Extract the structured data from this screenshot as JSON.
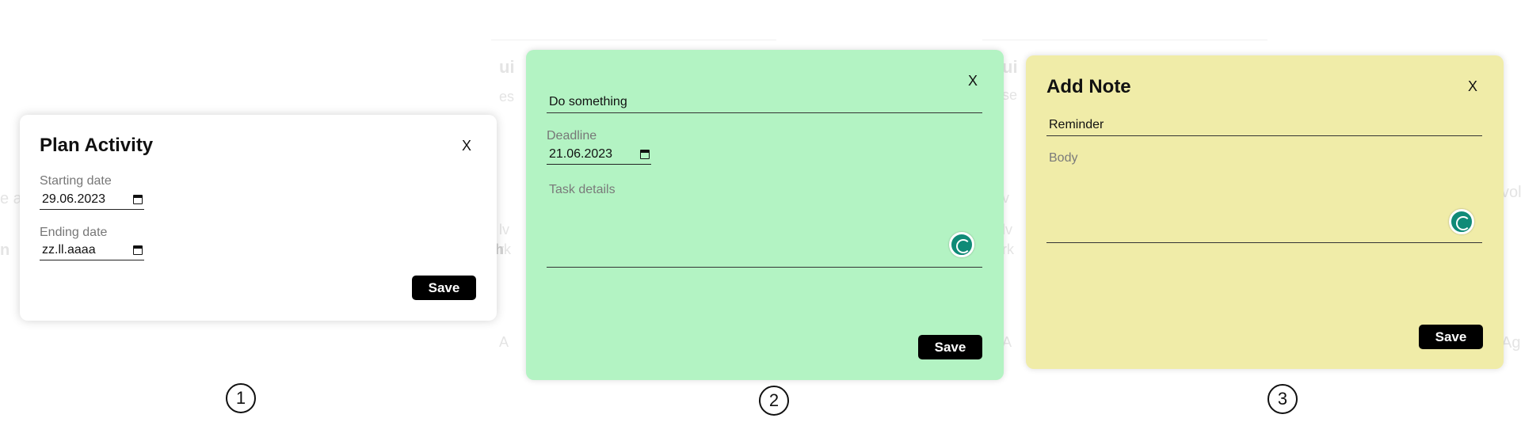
{
  "colors": {
    "modal1_bg": "#ffffff",
    "modal2_bg": "#b3f3c3",
    "modal3_bg": "#f0eca8",
    "button_bg": "#000000",
    "button_text": "#ffffff",
    "grammarly_icon": "#0f8a77"
  },
  "plan_activity": {
    "title": "Plan Activity",
    "close_label": "X",
    "starting_date_label": "Starting date",
    "starting_date_value": "29.06.2023",
    "ending_date_label": "Ending date",
    "ending_date_value": "zz.ll.aaaa",
    "save_label": "Save"
  },
  "task": {
    "close_label": "X",
    "title_value": "Do something",
    "deadline_label": "Deadline",
    "deadline_value": "21.06.2023",
    "details_placeholder": "Task details",
    "save_label": "Save",
    "icon": "grammarly-icon"
  },
  "add_note": {
    "title": "Add Note",
    "close_label": "X",
    "title_value": "Reminder",
    "body_placeholder": "Body",
    "save_label": "Save",
    "icon": "grammarly-icon"
  },
  "markers": [
    "1",
    "2",
    "3"
  ]
}
